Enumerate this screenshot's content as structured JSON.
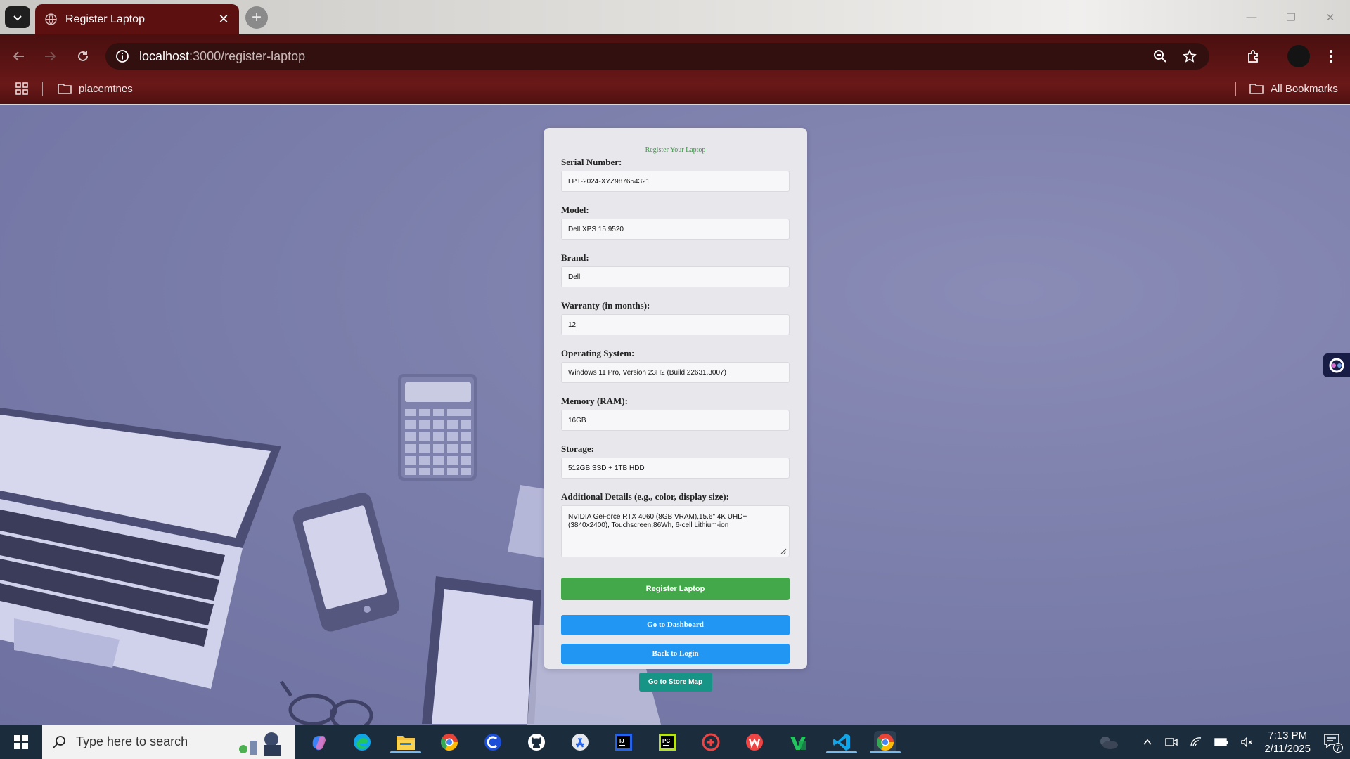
{
  "browser": {
    "tab_title": "Register Laptop",
    "tab_close": "✕",
    "new_tab": "+",
    "url_host": "localhost",
    "url_path": ":3000/register-laptop",
    "bookmarks": [
      {
        "label": "placemtnes",
        "icon": "folder-icon"
      },
      {
        "label": "All Bookmarks",
        "icon": "folder-icon"
      }
    ],
    "window_controls": [
      "—",
      "❐",
      "✕"
    ]
  },
  "form": {
    "title": "Register Your Laptop",
    "fields": [
      {
        "label": "Serial Number:",
        "value": "LPT-2024-XYZ987654321"
      },
      {
        "label": "Model:",
        "value": "Dell XPS 15 9520"
      },
      {
        "label": "Brand:",
        "value": "Dell"
      },
      {
        "label": "Warranty (in months):",
        "value": "12"
      },
      {
        "label": "Operating System:",
        "value": "Windows 11 Pro, Version 23H2 (Build 22631.3007)"
      },
      {
        "label": "Memory (RAM):",
        "value": "16GB"
      },
      {
        "label": "Storage:",
        "value": "512GB SSD + 1TB HDD"
      }
    ],
    "details": {
      "label": "Additional Details (e.g., color, display size):",
      "value": "NVIDIA GeForce RTX 4060 (8GB VRAM),15.6\" 4K UHD+ (3840x2400), Touchscreen,86Wh, 6-cell Lithium-ion"
    },
    "submit_label": "Register Laptop",
    "dashboard_label": "Go to Dashboard",
    "login_label": "Back to Login",
    "store_map_label": "Go to Store Map"
  },
  "taskbar": {
    "search_placeholder": "Type here to search",
    "time": "7:13 PM",
    "date": "2/11/2025",
    "notification_count": "7",
    "apps": [
      "copilot-icon",
      "edge-icon",
      "file-explorer-icon",
      "chrome-icon",
      "ccleaner-icon",
      "github-icon",
      "app-store-icon",
      "intellij-icon",
      "pycharm-icon",
      "game-icon",
      "wps-icon",
      "vscode-insiders-icon",
      "vscode-icon",
      "chrome-active-icon"
    ]
  },
  "colors": {
    "page_bg": "#7d80ab",
    "card_bg": "#e7e7ec",
    "title_green": "#3a9a45",
    "button_green": "#43a84a",
    "button_blue": "#2196f3",
    "button_teal": "#169485",
    "toolbar_red": "#5b1414"
  }
}
